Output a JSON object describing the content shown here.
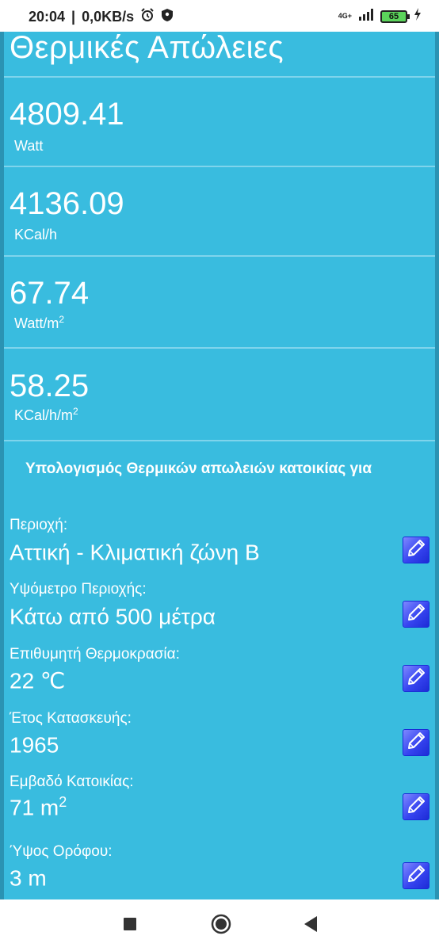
{
  "status": {
    "time": "20:04",
    "speed": "0,0KB/s",
    "network": "4G+",
    "battery": "65"
  },
  "app": {
    "title": "Θερμικές Απώλειες",
    "results": [
      {
        "value": "4809.41",
        "unit": "Watt",
        "unit_sup": ""
      },
      {
        "value": "4136.09",
        "unit": "KCal/h",
        "unit_sup": ""
      },
      {
        "value": "67.74",
        "unit": "Watt/m",
        "unit_sup": "2"
      },
      {
        "value": "58.25",
        "unit": "KCal/h/m",
        "unit_sup": "2"
      }
    ],
    "heading": "Υπολογισμός Θερμικών απωλειών κατοικίας για",
    "fields": [
      {
        "label": "Περιοχή:",
        "value": "Αττική - Κλιματική ζώνη Β",
        "value_sup": ""
      },
      {
        "label": "Υψόμετρο Περιοχής:",
        "value": "Κάτω από 500 μέτρα",
        "value_sup": ""
      },
      {
        "label": "Επιθυμητή Θερμοκρασία:",
        "value": "22 ℃",
        "value_sup": ""
      },
      {
        "label": "Έτος Κατασκευής:",
        "value": "1965",
        "value_sup": ""
      },
      {
        "label": "Εμβαδό Κατοικίας:",
        "value": "71 m",
        "value_sup": "2"
      },
      {
        "label": "Ύψος Ορόφου:",
        "value": "3 m",
        "value_sup": ""
      }
    ]
  },
  "colors": {
    "background": "#39bcdf",
    "edit_button": "#3644f0"
  },
  "icons": {
    "edit": "pencil-icon",
    "alarm": "alarm-icon",
    "shield": "shield-icon",
    "nav_recents": "square-icon",
    "nav_home": "circle-icon",
    "nav_back": "triangle-back-icon"
  }
}
